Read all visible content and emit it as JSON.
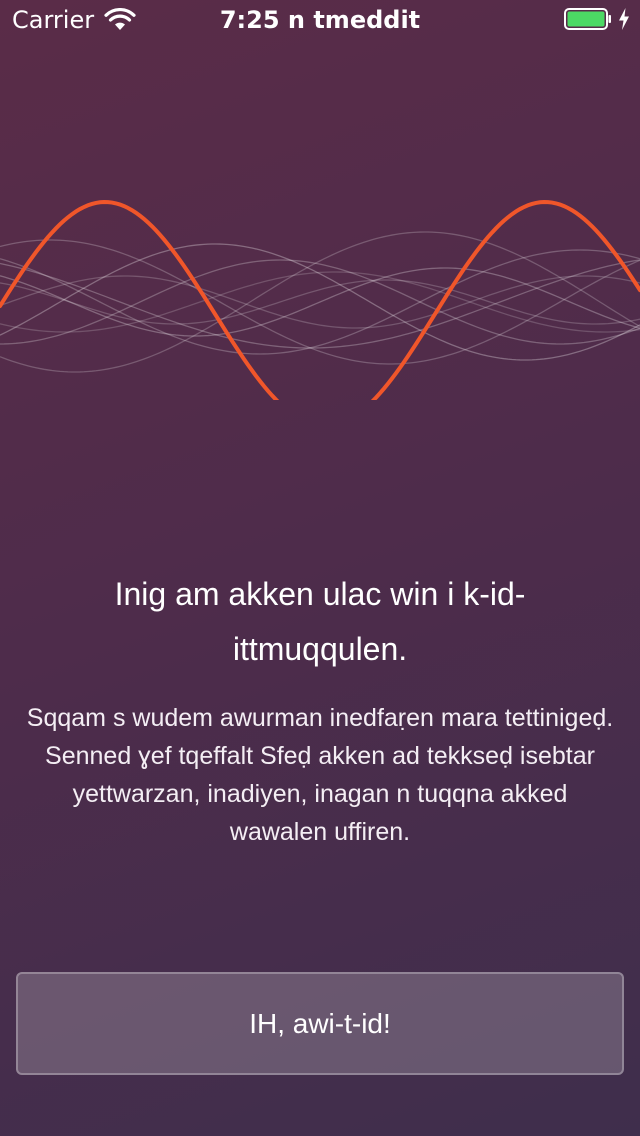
{
  "status_bar": {
    "carrier": "Carrier",
    "time": "7:25 n tmeddit",
    "battery_level": 1.0,
    "charging": true,
    "battery_color": "#4cd964"
  },
  "illustration": {
    "icon": "sound-wave-illustration",
    "accent_color": "#f0562a",
    "secondary_color": "#ffffff"
  },
  "onboarding": {
    "headline": "Inig am akken ulac win i k-id-ittmuqqulen.",
    "description": "Sqqam s wudem awurman inedfaṛen mara tettinigeḍ. Senned ɣef tqeffalt Sfeḍ akken ad tekkseḍ isebtar yettwarzan, inadiyen, inagan n tuqqna akked wawalen uffiren.",
    "button_label": "IH, awi-t-id!"
  },
  "theme": {
    "background_start": "#5a2c48",
    "background_end": "#3f2e4c"
  }
}
